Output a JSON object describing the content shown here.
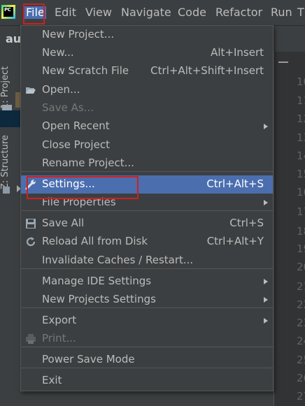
{
  "menubar": {
    "logo_text": "PC",
    "items": [
      "File",
      "Edit",
      "View",
      "Navigate",
      "Code",
      "Refactor",
      "Run",
      "T"
    ]
  },
  "editor": {
    "tab_text": "au",
    "gutter_numbers": [
      "10",
      "11",
      "12",
      "13",
      "14",
      "15",
      "16",
      "17",
      "18",
      "19",
      "20",
      "21",
      "22",
      "23",
      "24",
      "25",
      "26",
      "27"
    ]
  },
  "toolstrip": {
    "project_tab": "1: Project",
    "structure_tab": "Z: Structure"
  },
  "file_menu": {
    "items": [
      {
        "label": "New Project...",
        "shortcut": "",
        "submenu": false,
        "disabled": false,
        "icon": ""
      },
      {
        "label": "New...",
        "shortcut": "Alt+Insert",
        "submenu": false,
        "disabled": false,
        "icon": ""
      },
      {
        "label": "New Scratch File",
        "shortcut": "Ctrl+Alt+Shift+Insert",
        "submenu": false,
        "disabled": false,
        "icon": ""
      },
      {
        "label": "Open...",
        "shortcut": "",
        "submenu": false,
        "disabled": false,
        "icon": "folder-open-icon"
      },
      {
        "label": "Save As...",
        "shortcut": "",
        "submenu": false,
        "disabled": true,
        "icon": ""
      },
      {
        "label": "Open Recent",
        "shortcut": "",
        "submenu": true,
        "disabled": false,
        "icon": ""
      },
      {
        "label": "Close Project",
        "shortcut": "",
        "submenu": false,
        "disabled": false,
        "icon": ""
      },
      {
        "label": "Rename Project...",
        "shortcut": "",
        "submenu": false,
        "disabled": false,
        "icon": ""
      },
      {
        "label": "Settings...",
        "shortcut": "Ctrl+Alt+S",
        "submenu": false,
        "disabled": false,
        "icon": "wrench-icon",
        "selected": true
      },
      {
        "label": "File Properties",
        "shortcut": "",
        "submenu": true,
        "disabled": false,
        "icon": ""
      },
      {
        "label": "Save All",
        "shortcut": "Ctrl+S",
        "submenu": false,
        "disabled": false,
        "icon": "floppy-disk-icon"
      },
      {
        "label": "Reload All from Disk",
        "shortcut": "Ctrl+Alt+Y",
        "submenu": false,
        "disabled": false,
        "icon": "reload-icon"
      },
      {
        "label": "Invalidate Caches / Restart...",
        "shortcut": "",
        "submenu": false,
        "disabled": false,
        "icon": ""
      },
      {
        "label": "Manage IDE Settings",
        "shortcut": "",
        "submenu": true,
        "disabled": false,
        "icon": ""
      },
      {
        "label": "New Projects Settings",
        "shortcut": "",
        "submenu": true,
        "disabled": false,
        "icon": ""
      },
      {
        "label": "Export",
        "shortcut": "",
        "submenu": true,
        "disabled": false,
        "icon": ""
      },
      {
        "label": "Print...",
        "shortcut": "",
        "submenu": false,
        "disabled": true,
        "icon": "printer-icon"
      },
      {
        "label": "Power Save Mode",
        "shortcut": "",
        "submenu": false,
        "disabled": false,
        "icon": ""
      },
      {
        "label": "Exit",
        "shortcut": "",
        "submenu": false,
        "disabled": false,
        "icon": ""
      }
    ]
  },
  "colors": {
    "background": "#3c3f41",
    "selection": "#4b6eaf",
    "highlight_box": "#d11e1e",
    "text": "#bbbbbb",
    "disabled_text": "#777777"
  }
}
